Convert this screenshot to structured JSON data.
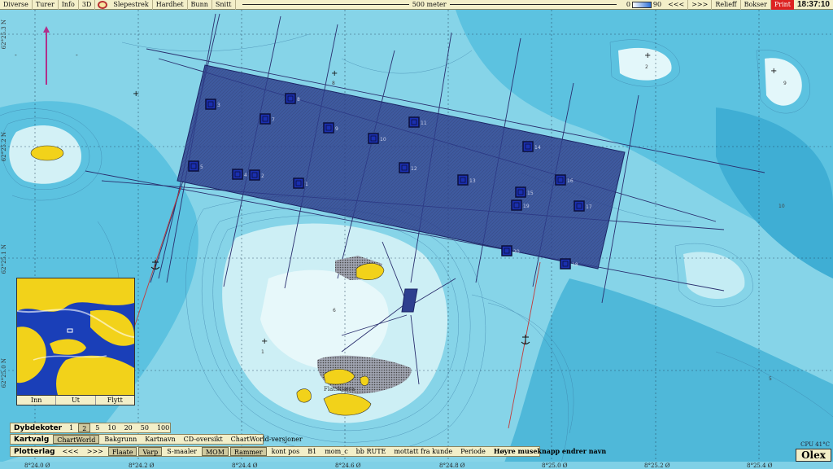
{
  "topbar": {
    "items": [
      "Diverse",
      "Turer",
      "Info",
      "3D"
    ],
    "items2": [
      "Slepestrek",
      "Hardhet",
      "Bunn",
      "Snitt"
    ],
    "scale_label": "500 meter",
    "depth_min": "0",
    "depth_max": "90",
    "nav_back": "<<<",
    "nav_fwd": ">>>",
    "relieff": "Relieff",
    "bokser": "Bokser",
    "print": "Print",
    "clock": "18:37:10"
  },
  "map": {
    "lat_labels": [
      "62°25.3 N",
      "62°25.2 N",
      "62°25.1 N",
      "62°25.0 N"
    ],
    "lon_labels": [
      "8°24.0 Ø",
      "8°24.2 Ø",
      "8°24.4 Ø",
      "8°24.6 Ø",
      "8°24.8 Ø",
      "8°25.0 Ø",
      "8°25.2 Ø",
      "8°25.4 Ø"
    ],
    "place_name": "Flatskjæra",
    "grid_numbers": [
      "6",
      "8",
      "9",
      "10",
      "1",
      "2",
      "5"
    ],
    "colors": {
      "shallow": "#d9f4f7",
      "mid": "#8fdaea",
      "deep": "#3fb2d6",
      "box": "#2e3f8f",
      "land": "#f2d21a"
    }
  },
  "boxes": [
    {
      "n": "3"
    },
    {
      "n": "7"
    },
    {
      "n": "8"
    },
    {
      "n": "9"
    },
    {
      "n": "11"
    },
    {
      "n": "10"
    },
    {
      "n": "14"
    },
    {
      "n": "5"
    },
    {
      "n": "4"
    },
    {
      "n": "2"
    },
    {
      "n": "1"
    },
    {
      "n": "12"
    },
    {
      "n": "13"
    },
    {
      "n": "16"
    },
    {
      "n": "15"
    },
    {
      "n": "19"
    },
    {
      "n": "17"
    },
    {
      "n": "20"
    },
    {
      "n": "18"
    }
  ],
  "inset": {
    "buttons": [
      "Inn",
      "Ut",
      "Flytt"
    ]
  },
  "dybdekoter": {
    "title": "Dybdekoter",
    "values": [
      "1",
      "2",
      "5",
      "10",
      "20",
      "50",
      "100"
    ],
    "selected": "2"
  },
  "kartvalg": {
    "title": "Kartvalg",
    "items": [
      "ChartWorld",
      "Bakgrunn",
      "Kartnavn",
      "CD-oversikt",
      "ChartWorld-versjoner"
    ],
    "selected": "ChartWorld"
  },
  "plotterlag": {
    "title": "Plotterlag",
    "nav": [
      "<<<",
      ">>>"
    ],
    "items": [
      "Flaate",
      "Varp",
      "S-maaler",
      "MOM",
      "Rammer",
      "kont pos",
      "B1",
      "mom_c",
      "bb RUTE",
      "mottatt fra kunde",
      "Periode"
    ],
    "active": [
      "Flaate",
      "Varp",
      "MOM",
      "Rammer"
    ],
    "hint": "Høyre museknapp endrer navn"
  },
  "status": {
    "cpu": "CPU 41°C",
    "brand": "Olex"
  }
}
